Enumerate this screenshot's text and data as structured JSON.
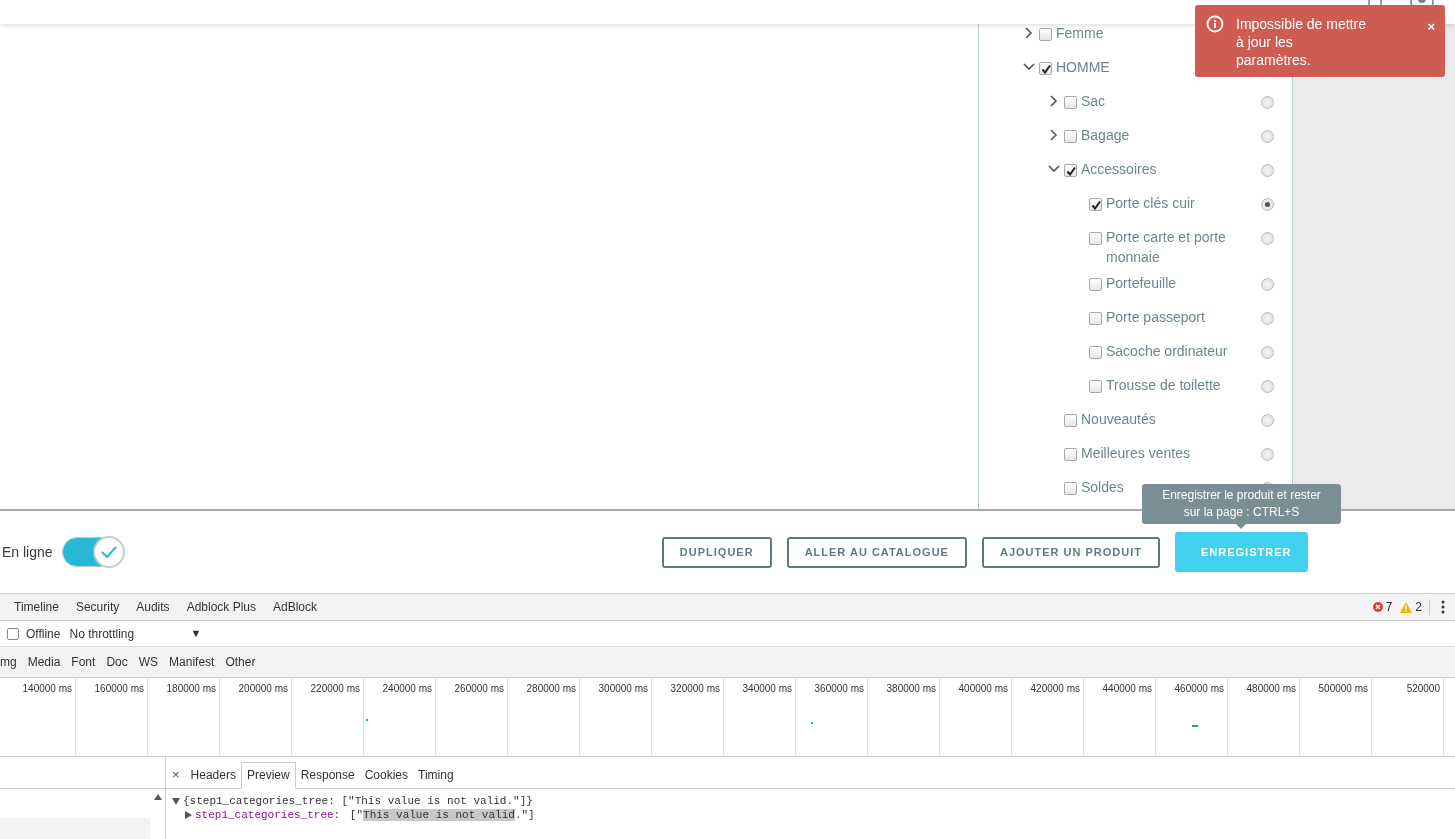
{
  "category_tree": {
    "items": [
      {
        "label": "Femme",
        "checked": false,
        "expanded": false
      },
      {
        "label": "HOMME",
        "checked": true,
        "expanded": true,
        "children": [
          {
            "label": "Sac",
            "checked": false,
            "expanded": false,
            "selected": false
          },
          {
            "label": "Bagage",
            "checked": false,
            "expanded": false,
            "selected": false
          },
          {
            "label": "Accessoires",
            "checked": true,
            "expanded": true,
            "selected": false,
            "children": [
              {
                "label": "Porte clés cuir",
                "checked": true,
                "selected": true
              },
              {
                "label": "Porte carte et porte monnaie",
                "checked": false,
                "selected": false
              },
              {
                "label": "Portefeuille",
                "checked": false,
                "selected": false
              },
              {
                "label": "Porte passeport",
                "checked": false,
                "selected": false
              },
              {
                "label": "Sacoche ordinateur",
                "checked": false,
                "selected": false
              },
              {
                "label": "Trousse de toilette",
                "checked": false,
                "selected": false
              }
            ]
          },
          {
            "label": "Nouveautés",
            "checked": false,
            "selected": false
          },
          {
            "label": "Meilleures ventes",
            "checked": false,
            "selected": false
          },
          {
            "label": "Soldes",
            "checked": false,
            "selected": false
          }
        ]
      }
    ]
  },
  "toast": {
    "message": "Impossible de mettre à jour les paramètres.",
    "close": "×"
  },
  "footer": {
    "online_label": "En ligne",
    "online": true,
    "buttons": [
      {
        "label": "DUPLIQUER",
        "kind": "outline"
      },
      {
        "label": "ALLER AU CATALOGUE",
        "kind": "outline"
      },
      {
        "label": "AJOUTER UN PRODUIT",
        "kind": "outline"
      },
      {
        "label": "ENREGISTRER",
        "kind": "primary"
      }
    ],
    "tooltip": "Enregistrer le produit et rester sur la page : CTRL+S"
  },
  "devtools": {
    "tabs": [
      "Timeline",
      "Security",
      "Audits",
      "Adblock Plus",
      "AdBlock"
    ],
    "error_count": "7",
    "warning_count": "2",
    "offline": {
      "label": "Offline",
      "checked": false
    },
    "throttling": {
      "value": "No throttling",
      "arrow": "▼"
    },
    "filters": [
      "mg",
      "Media",
      "Font",
      "Doc",
      "WS",
      "Manifest",
      "Other"
    ],
    "overview_ticks": [
      "140000 ms",
      "160000 ms",
      "180000 ms",
      "200000 ms",
      "220000 ms",
      "240000 ms",
      "260000 ms",
      "280000 ms",
      "300000 ms",
      "320000 ms",
      "340000 ms",
      "360000 ms",
      "380000 ms",
      "400000 ms",
      "420000 ms",
      "440000 ms",
      "460000 ms",
      "480000 ms",
      "500000 ms",
      "520000"
    ],
    "detail_close": "×",
    "detail_tabs": [
      {
        "label": "Headers",
        "selected": false
      },
      {
        "label": "Preview",
        "selected": true
      },
      {
        "label": "Response",
        "selected": false
      },
      {
        "label": "Cookies",
        "selected": false
      },
      {
        "label": "Timing",
        "selected": false
      }
    ],
    "preview": {
      "root_expanded": true,
      "root_text": "{step1_categories_tree: [\"This value is not valid.\"]}",
      "child": {
        "expanded": false,
        "key": "step1_categories_tree:",
        "value_before": " [\"",
        "value_selected": "This value is not valid",
        "value_after": ".\"]"
      }
    }
  }
}
